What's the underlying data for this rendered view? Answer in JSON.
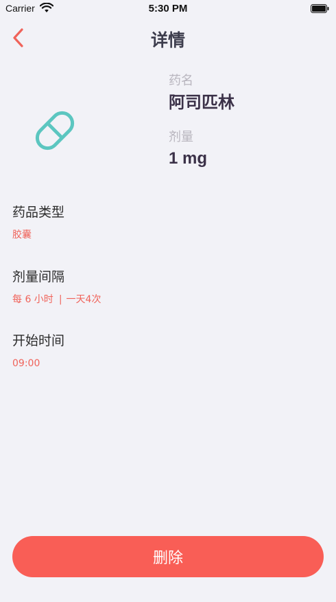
{
  "status_bar": {
    "carrier": "Carrier",
    "time": "5:30 PM"
  },
  "nav": {
    "title": "详情",
    "back_icon": "chevron-left-icon",
    "accent_color": "#f0635a"
  },
  "medication": {
    "icon": "pill-icon",
    "icon_color": "#5cc6c0",
    "name_label": "药名",
    "name": "阿司匹林",
    "dose_label": "剂量",
    "dose": "1 mg"
  },
  "details": {
    "type_title": "药品类型",
    "type_value": "胶囊",
    "interval_title": "剂量间隔",
    "interval_value": "每 6 小时",
    "interval_separator": "|",
    "interval_frequency": "一天4次",
    "start_title": "开始时间",
    "start_value": "09:00"
  },
  "actions": {
    "delete_label": "删除",
    "delete_color": "#f95e56"
  }
}
